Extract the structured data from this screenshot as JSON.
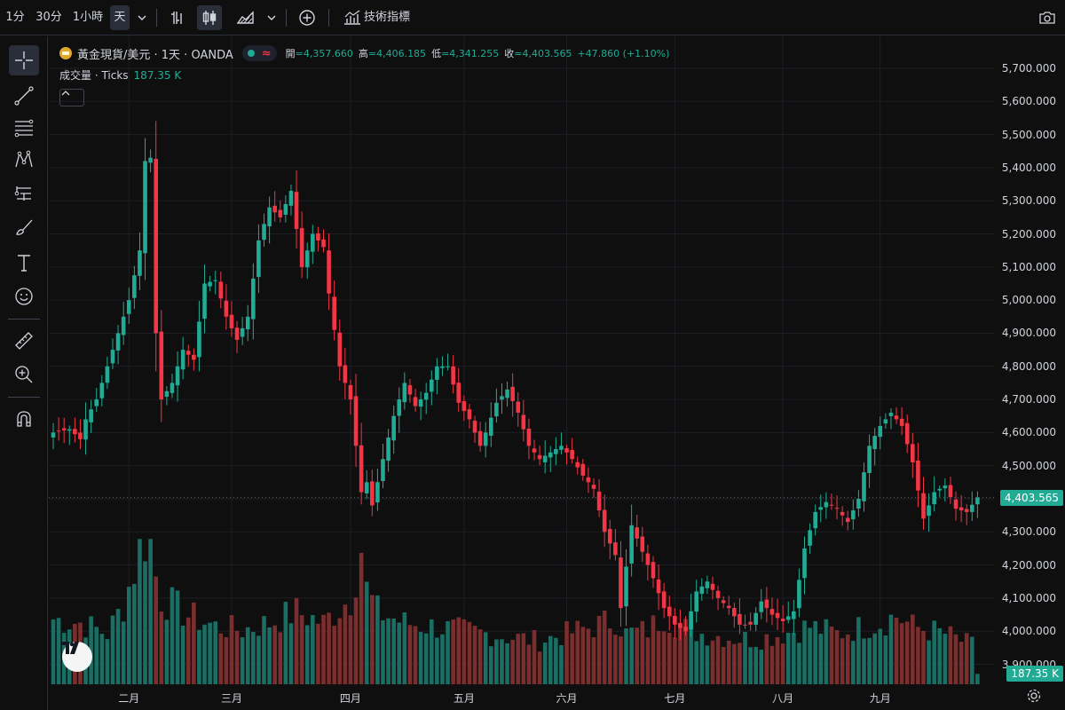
{
  "toolbar": {
    "intervals": [
      "1分",
      "30分",
      "1小時",
      "天"
    ],
    "active_interval": "天",
    "indicators_label": "技術指標"
  },
  "legend": {
    "symbol": "黃金現貨/美元 · 1天 · OANDA",
    "open_key": "開",
    "open": "=4,357.660",
    "high_key": "高",
    "high": "=4,406.185",
    "low_key": "低",
    "low": "=4,341.255",
    "close_key": "收",
    "close": "=4,403.565",
    "change": "+47.860 (+1.10%)"
  },
  "volume": {
    "label": "成交量 · Ticks",
    "value": "187.35 K"
  },
  "price_tag": "4,403.565",
  "volume_tag": "187.35 K",
  "colors": {
    "up": "#22ab94",
    "down": "#f23645",
    "up_vol": "#1b6e63",
    "down_vol": "#7a2e2e",
    "bg": "#0f0f0f",
    "grid": "#1c1f26"
  },
  "chart_data": {
    "type": "candlestick",
    "y_ticks": [
      "5,700.000",
      "5,600.000",
      "5,500.000",
      "5,400.000",
      "5,300.000",
      "5,200.000",
      "5,100.000",
      "5,000.000",
      "4,900.000",
      "4,800.000",
      "4,700.000",
      "4,600.000",
      "4,500.000",
      "4,400.000",
      "4,300.000",
      "4,200.000",
      "4,100.000",
      "4,000.000",
      "3,900.000"
    ],
    "y_tick_values": [
      5700,
      5600,
      5500,
      5400,
      5300,
      5200,
      5100,
      5000,
      4900,
      4800,
      4700,
      4600,
      4500,
      4400,
      4300,
      4200,
      4100,
      4000,
      3900
    ],
    "x_labels": [
      "二月",
      "三月",
      "四月",
      "五月",
      "六月",
      "七月",
      "八月",
      "九月"
    ],
    "x_label_index": [
      14,
      33,
      55,
      76,
      95,
      115,
      135,
      153
    ],
    "ylim": [
      3860,
      5760
    ],
    "candle_count": 172,
    "close_anchors": [
      [
        0,
        4600
      ],
      [
        3,
        4610
      ],
      [
        5,
        4580
      ],
      [
        6,
        4640
      ],
      [
        8,
        4700
      ],
      [
        10,
        4800
      ],
      [
        12,
        4900
      ],
      [
        14,
        5000
      ],
      [
        16,
        5150
      ],
      [
        17,
        5420
      ],
      [
        18,
        5430
      ],
      [
        19,
        4900
      ],
      [
        20,
        4700
      ],
      [
        22,
        4750
      ],
      [
        24,
        4850
      ],
      [
        26,
        4820
      ],
      [
        28,
        5050
      ],
      [
        30,
        5060
      ],
      [
        32,
        4950
      ],
      [
        34,
        4880
      ],
      [
        36,
        4950
      ],
      [
        38,
        5180
      ],
      [
        40,
        5280
      ],
      [
        42,
        5250
      ],
      [
        44,
        5330
      ],
      [
        46,
        5100
      ],
      [
        48,
        5200
      ],
      [
        50,
        5160
      ],
      [
        51,
        5020
      ],
      [
        53,
        4800
      ],
      [
        55,
        4700
      ],
      [
        57,
        4420
      ],
      [
        58,
        4450
      ],
      [
        59,
        4380
      ],
      [
        61,
        4520
      ],
      [
        63,
        4650
      ],
      [
        65,
        4750
      ],
      [
        67,
        4680
      ],
      [
        69,
        4720
      ],
      [
        71,
        4800
      ],
      [
        73,
        4800
      ],
      [
        75,
        4690
      ],
      [
        77,
        4640
      ],
      [
        79,
        4560
      ],
      [
        80,
        4600
      ],
      [
        82,
        4690
      ],
      [
        84,
        4730
      ],
      [
        86,
        4660
      ],
      [
        88,
        4560
      ],
      [
        90,
        4520
      ],
      [
        92,
        4540
      ],
      [
        94,
        4560
      ],
      [
        96,
        4520
      ],
      [
        98,
        4470
      ],
      [
        100,
        4430
      ],
      [
        102,
        4300
      ],
      [
        104,
        4230
      ],
      [
        105,
        4070
      ],
      [
        107,
        4320
      ],
      [
        109,
        4240
      ],
      [
        111,
        4160
      ],
      [
        113,
        4070
      ],
      [
        115,
        4020
      ],
      [
        117,
        4000
      ],
      [
        119,
        4120
      ],
      [
        121,
        4150
      ],
      [
        123,
        4100
      ],
      [
        125,
        4070
      ],
      [
        127,
        4020
      ],
      [
        129,
        4020
      ],
      [
        131,
        4090
      ],
      [
        133,
        4050
      ],
      [
        135,
        4030
      ],
      [
        137,
        4060
      ],
      [
        139,
        4250
      ],
      [
        141,
        4360
      ],
      [
        143,
        4390
      ],
      [
        145,
        4370
      ],
      [
        147,
        4330
      ],
      [
        149,
        4400
      ],
      [
        151,
        4560
      ],
      [
        153,
        4620
      ],
      [
        155,
        4660
      ],
      [
        157,
        4620
      ],
      [
        159,
        4510
      ],
      [
        161,
        4340
      ],
      [
        163,
        4420
      ],
      [
        165,
        4440
      ],
      [
        167,
        4370
      ],
      [
        169,
        4360
      ],
      [
        171,
        4404
      ]
    ],
    "volume_anchors": [
      [
        0,
        90
      ],
      [
        5,
        85
      ],
      [
        10,
        70
      ],
      [
        13,
        110
      ],
      [
        15,
        160
      ],
      [
        16,
        185
      ],
      [
        17,
        205
      ],
      [
        18,
        195
      ],
      [
        19,
        150
      ],
      [
        20,
        120
      ],
      [
        25,
        95
      ],
      [
        30,
        80
      ],
      [
        35,
        75
      ],
      [
        40,
        85
      ],
      [
        45,
        100
      ],
      [
        50,
        85
      ],
      [
        55,
        120
      ],
      [
        57,
        190
      ],
      [
        58,
        130
      ],
      [
        60,
        100
      ],
      [
        65,
        85
      ],
      [
        70,
        80
      ],
      [
        75,
        75
      ],
      [
        80,
        70
      ],
      [
        85,
        65
      ],
      [
        90,
        60
      ],
      [
        95,
        70
      ],
      [
        100,
        80
      ],
      [
        104,
        90
      ],
      [
        106,
        70
      ],
      [
        110,
        75
      ],
      [
        113,
        95
      ],
      [
        116,
        80
      ],
      [
        120,
        70
      ],
      [
        125,
        65
      ],
      [
        130,
        62
      ],
      [
        135,
        70
      ],
      [
        140,
        80
      ],
      [
        145,
        70
      ],
      [
        150,
        80
      ],
      [
        153,
        85
      ],
      [
        156,
        95
      ],
      [
        159,
        80
      ],
      [
        162,
        75
      ],
      [
        165,
        70
      ],
      [
        168,
        60
      ],
      [
        170,
        55
      ],
      [
        171,
        15
      ]
    ],
    "volume_max": 270
  }
}
